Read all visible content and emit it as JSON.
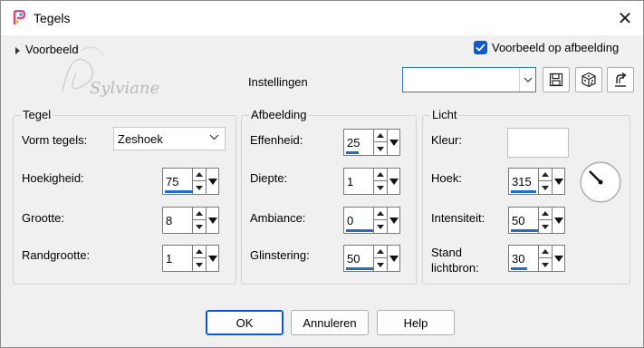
{
  "window": {
    "title": "Tegels",
    "close_glyph": "✕"
  },
  "preview": {
    "label": "Voorbeeld",
    "on_image_label": "Voorbeeld op afbeelding",
    "on_image_checked": true
  },
  "watermark": {
    "text": "Sylviane"
  },
  "settings": {
    "label": "Instellingen",
    "preset_value": ""
  },
  "tegel": {
    "title": "Tegel",
    "shape_label": "Vorm tegels:",
    "shape_value": "Zeshoek",
    "angularity_label": "Hoekigheid:",
    "angularity_value": "75",
    "size_label": "Grootte:",
    "size_value": "8",
    "border_label": "Randgrootte:",
    "border_value": "1"
  },
  "afbeelding": {
    "title": "Afbeelding",
    "smoothness_label": "Effenheid:",
    "smoothness_value": "25",
    "depth_label": "Diepte:",
    "depth_value": "1",
    "ambiance_label": "Ambiance:",
    "ambiance_value": "0",
    "shininess_label": "Glinstering:",
    "shininess_value": "50"
  },
  "licht": {
    "title": "Licht",
    "color_label": "Kleur:",
    "color_value": "#ffffff",
    "angle_label": "Hoek:",
    "angle_value": "315",
    "intensity_label": "Intensiteit:",
    "intensity_value": "50",
    "elevation_label_line1": "Stand",
    "elevation_label_line2": "lichtbron:",
    "elevation_value": "30"
  },
  "buttons": {
    "ok": "OK",
    "cancel": "Annuleren",
    "help": "Help"
  },
  "icons": [
    "app-icon",
    "close-icon",
    "save-preset-icon",
    "randomize-icon",
    "reset-icon",
    "checkbox-checked-icon",
    "angle-dial-icon"
  ],
  "colors": {
    "accent": "#0a5ad4",
    "window_bg": "#f0f0f0",
    "value_bar": "#1d6fcf"
  }
}
